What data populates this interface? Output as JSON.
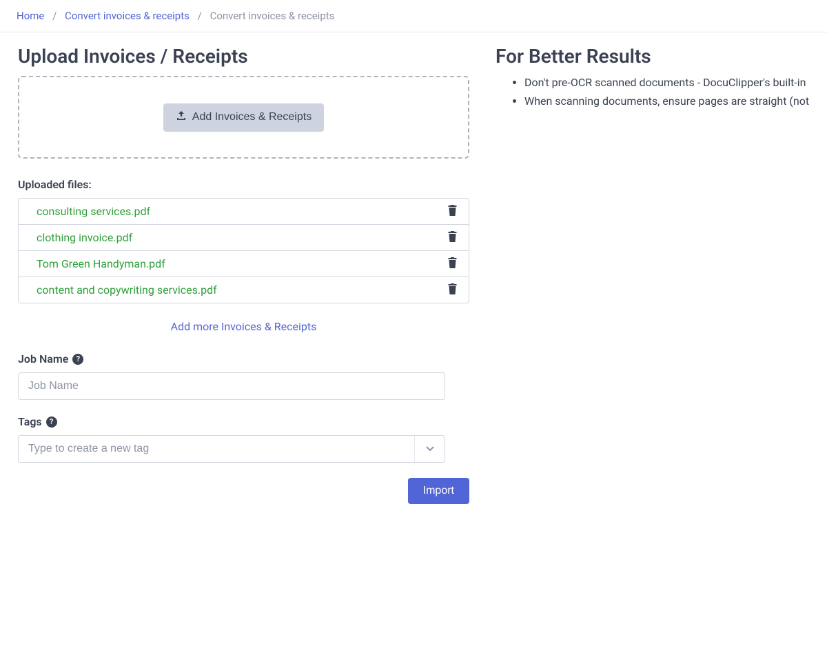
{
  "breadcrumb": {
    "home": "Home",
    "convert_link": "Convert invoices & receipts",
    "current": "Convert invoices & receipts"
  },
  "left": {
    "title": "Upload Invoices / Receipts",
    "add_button": "Add Invoices & Receipts",
    "uploaded_label": "Uploaded files:",
    "files": [
      "consulting services.pdf",
      "clothing invoice.pdf",
      "Tom Green Handyman.pdf",
      "content and copywriting services.pdf"
    ],
    "add_more": "Add more Invoices & Receipts",
    "job_name_label": "Job Name",
    "job_name_placeholder": "Job Name",
    "tags_label": "Tags",
    "tags_placeholder": "Type to create a new tag",
    "import_button": "Import"
  },
  "right": {
    "title": "For Better Results",
    "tips": [
      "Don't pre-OCR scanned documents - DocuClipper's built-in OCR",
      "When scanning documents, ensure pages are straight (not tilted"
    ]
  }
}
